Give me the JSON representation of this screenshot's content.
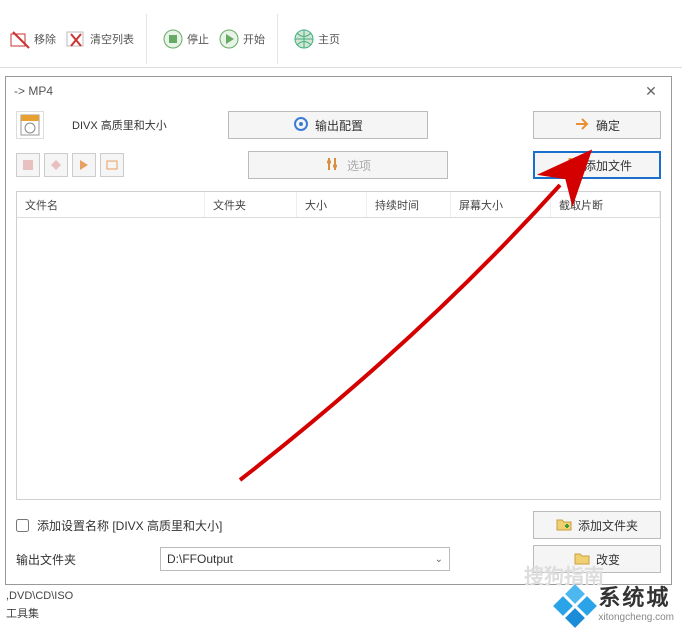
{
  "toolbar": {
    "remove": "移除",
    "clear": "清空列表",
    "stop": "停止",
    "start": "开始",
    "home": "主页"
  },
  "dialog": {
    "title": " -> MP4",
    "profile_label": "DIVX 高质里和大小",
    "output_config_btn": "输出配置",
    "confirm_btn": "确定",
    "options_btn": "选项",
    "add_file_btn": "添加文件",
    "columns": {
      "name": "文件名",
      "folder": "文件夹",
      "size": "大小",
      "duration": "持续时间",
      "screen": "屏幕大小",
      "clip": "截取片断"
    },
    "add_setting_checkbox": "添加设置名称 [DIVX 高质里和大小]",
    "add_folder_btn": "添加文件夹",
    "output_folder_label": "输出文件夹",
    "output_folder_value": "D:\\FFOutput",
    "change_btn": "改变"
  },
  "side": {
    "line1": ",DVD\\CD\\ISO",
    "line2": "工具集"
  },
  "watermark": {
    "brand": "系统城",
    "url": "xitongcheng.com",
    "ghost": "搜狗指南"
  }
}
